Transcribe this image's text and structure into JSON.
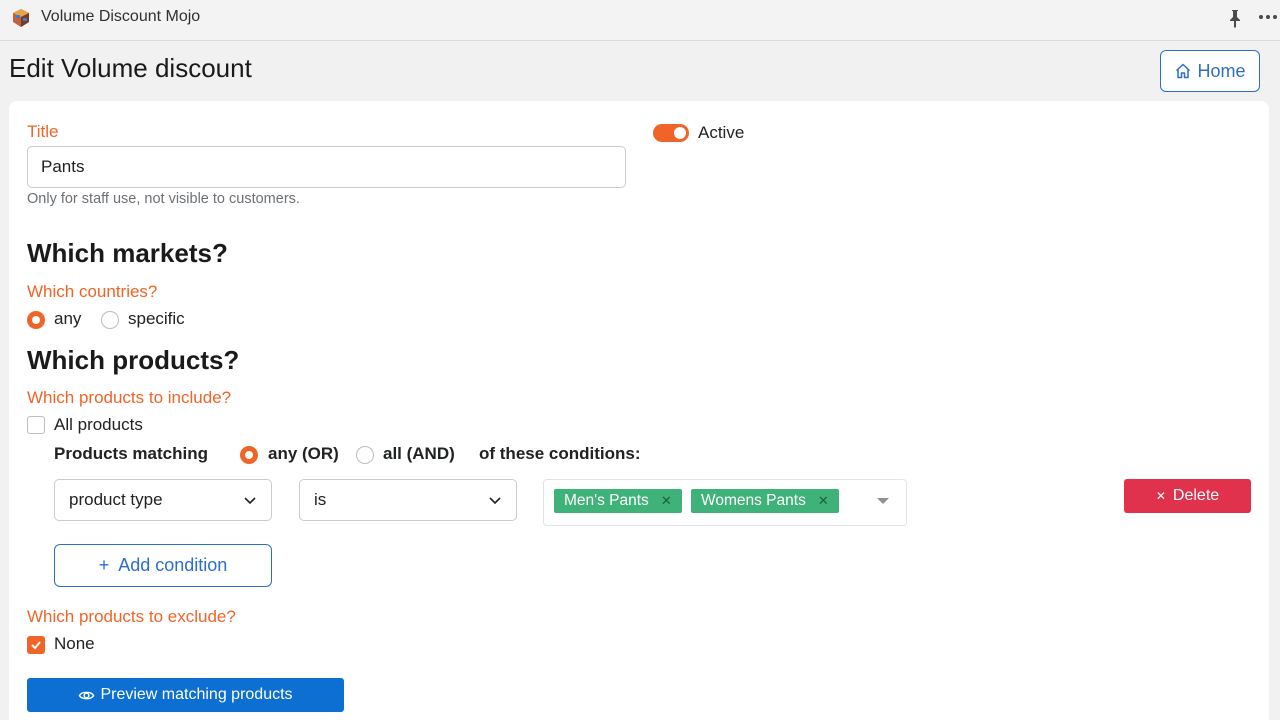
{
  "app": {
    "name": "Volume Discount Mojo"
  },
  "header": {
    "page_title": "Edit Volume discount",
    "home_label": "Home"
  },
  "title_field": {
    "label": "Title",
    "value": "Pants",
    "help": "Only for staff use, not visible to customers."
  },
  "active_toggle": {
    "label": "Active",
    "on": true
  },
  "markets": {
    "heading": "Which markets?",
    "countries_label": "Which countries?",
    "options": [
      "any",
      "specific"
    ],
    "selected": "any"
  },
  "products": {
    "heading": "Which products?",
    "include_label": "Which products to include?",
    "all_products_label": "All products",
    "all_products_checked": false,
    "matching_label": "Products matching",
    "match_any_label": "any (OR)",
    "match_all_label": "all (AND)",
    "match_selected": "any (OR)",
    "conditions_suffix": "of these conditions:",
    "condition": {
      "field": "product type",
      "operator": "is",
      "values": [
        "Men's Pants",
        "Womens Pants"
      ],
      "delete_label": "Delete"
    },
    "add_condition_label": "Add condition",
    "exclude_label": "Which products to exclude?",
    "none_label": "None",
    "none_checked": true,
    "preview_label": "Preview matching products"
  },
  "colors": {
    "accent": "#f06428",
    "link_blue": "#2c6ecb",
    "primary_blue": "#0d6fd1",
    "tag_green": "#3eb279",
    "danger": "#e0324c"
  },
  "icons": {
    "app_logo": "app-logo-icon",
    "pin": "pin-icon",
    "more": "more-icon",
    "home": "home-icon",
    "chevron": "chevron-down-icon",
    "tag_remove": "close-icon",
    "delete": "close-icon",
    "add": "plus-icon",
    "preview": "eye-icon",
    "check": "check-icon"
  }
}
